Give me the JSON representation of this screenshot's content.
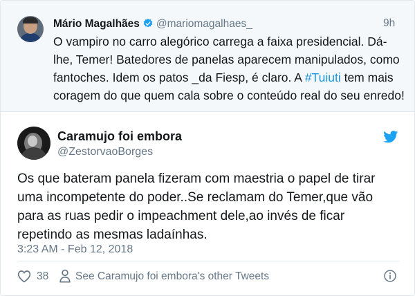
{
  "quoted_tweet": {
    "author_name": "Mário Magalhães",
    "handle": "@mariomagalhaes_",
    "time": "9h",
    "text_before_hashtag": "O vampiro no carro alegórico carrega a faixa presidencial. Dá-lhe, Temer! Batedores de panelas aparecem manipulados, como fantoches. Idem os patos _da Fiesp, é claro. A ",
    "hashtag": "#Tuiuti",
    "text_after_hashtag": " tem mais coragem do que quem cala sobre o conteúdo real do seu enredo!",
    "verified_icon": "verified-badge-icon"
  },
  "tweet": {
    "author_name": "Caramujo foi embora",
    "handle": "@ZestorvaoBorges",
    "text": "Os que bateram panela fizeram com maestria o papel de tirar uma incompetente do poder..Se reclamam do Temer,que vão para as ruas pedir o impeachment dele,ao invés de ficar repetindo as mesmas ladaínhas.",
    "date": "3:23 AM - Feb 12, 2018",
    "like_count": "38",
    "other_tweets_label": "See Caramujo foi embora's other Tweets",
    "brand_icon": "twitter-bird-icon"
  },
  "colors": {
    "accent": "#1da1f2",
    "link": "#1b95e0",
    "secondary_text": "#657786",
    "quoted_background": "#f5f8fa",
    "border": "#e1e8ed"
  }
}
